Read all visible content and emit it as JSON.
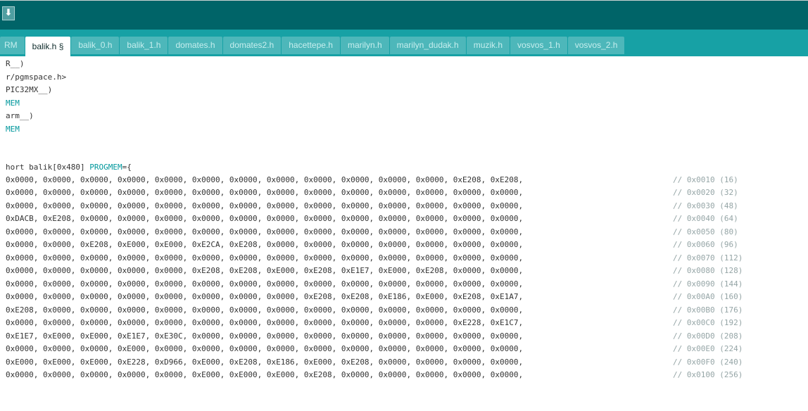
{
  "toolbar": {
    "upload_icon": "upload-arrow-icon",
    "upload_glyph": "🡇"
  },
  "tabs": [
    {
      "label": "RM",
      "active": false
    },
    {
      "label": "balik.h §",
      "active": true
    },
    {
      "label": "balik_0.h",
      "active": false
    },
    {
      "label": "balik_1.h",
      "active": false
    },
    {
      "label": "domates.h",
      "active": false
    },
    {
      "label": "domates2.h",
      "active": false
    },
    {
      "label": "hacettepe.h",
      "active": false
    },
    {
      "label": "marilyn.h",
      "active": false
    },
    {
      "label": "marilyn_dudak.h",
      "active": false
    },
    {
      "label": "muzik.h",
      "active": false
    },
    {
      "label": "vosvos_1.h",
      "active": false
    },
    {
      "label": "vosvos_2.h",
      "active": false
    }
  ],
  "editor": {
    "header_lines": [
      {
        "text": "R__)",
        "style": ""
      },
      {
        "text": "r/pgmspace.h>",
        "style": ""
      },
      {
        "text": "PIC32MX__)",
        "style": ""
      },
      {
        "text": "MEM",
        "style": "kw"
      },
      {
        "text": "arm__)",
        "style": ""
      },
      {
        "text": "MEM",
        "style": "kw"
      }
    ],
    "decl": {
      "prefix": "hort balik[0x480] ",
      "keyword": "PROGMEM",
      "suffix": "={"
    },
    "data_lines": [
      {
        "values": "0x0000, 0x0000, 0x0000, 0x0000, 0x0000, 0x0000, 0x0000, 0x0000, 0x0000, 0x0000, 0x0000, 0x0000, 0xE208, 0xE208,",
        "comment": "// 0x0010 (16)"
      },
      {
        "values": "0x0000, 0x0000, 0x0000, 0x0000, 0x0000, 0x0000, 0x0000, 0x0000, 0x0000, 0x0000, 0x0000, 0x0000, 0x0000, 0x0000,",
        "comment": "// 0x0020 (32)"
      },
      {
        "values": "0x0000, 0x0000, 0x0000, 0x0000, 0x0000, 0x0000, 0x0000, 0x0000, 0x0000, 0x0000, 0x0000, 0x0000, 0x0000, 0x0000,",
        "comment": "// 0x0030 (48)"
      },
      {
        "values": "0xDACB, 0xE208, 0x0000, 0x0000, 0x0000, 0x0000, 0x0000, 0x0000, 0x0000, 0x0000, 0x0000, 0x0000, 0x0000, 0x0000,",
        "comment": "// 0x0040 (64)"
      },
      {
        "values": "0x0000, 0x0000, 0x0000, 0x0000, 0x0000, 0x0000, 0x0000, 0x0000, 0x0000, 0x0000, 0x0000, 0x0000, 0x0000, 0x0000,",
        "comment": "// 0x0050 (80)"
      },
      {
        "values": "0x0000, 0x0000, 0xE208, 0xE000, 0xE000, 0xE2CA, 0xE208, 0x0000, 0x0000, 0x0000, 0x0000, 0x0000, 0x0000, 0x0000,",
        "comment": "// 0x0060 (96)"
      },
      {
        "values": "0x0000, 0x0000, 0x0000, 0x0000, 0x0000, 0x0000, 0x0000, 0x0000, 0x0000, 0x0000, 0x0000, 0x0000, 0x0000, 0x0000,",
        "comment": "// 0x0070 (112)"
      },
      {
        "values": "0x0000, 0x0000, 0x0000, 0x0000, 0x0000, 0xE208, 0xE208, 0xE000, 0xE208, 0xE1E7, 0xE000, 0xE208, 0x0000, 0x0000,",
        "comment": "// 0x0080 (128)"
      },
      {
        "values": "0x0000, 0x0000, 0x0000, 0x0000, 0x0000, 0x0000, 0x0000, 0x0000, 0x0000, 0x0000, 0x0000, 0x0000, 0x0000, 0x0000,",
        "comment": "// 0x0090 (144)"
      },
      {
        "values": "0x0000, 0x0000, 0x0000, 0x0000, 0x0000, 0x0000, 0x0000, 0x0000, 0xE208, 0xE208, 0xE186, 0xE000, 0xE208, 0xE1A7,",
        "comment": "// 0x00A0 (160)"
      },
      {
        "values": "0xE208, 0x0000, 0x0000, 0x0000, 0x0000, 0x0000, 0x0000, 0x0000, 0x0000, 0x0000, 0x0000, 0x0000, 0x0000, 0x0000,",
        "comment": "// 0x00B0 (176)"
      },
      {
        "values": "0x0000, 0x0000, 0x0000, 0x0000, 0x0000, 0x0000, 0x0000, 0x0000, 0x0000, 0x0000, 0x0000, 0x0000, 0xE228, 0xE1C7,",
        "comment": "// 0x00C0 (192)"
      },
      {
        "values": "0xE1E7, 0xE000, 0xE000, 0xE1E7, 0xE30C, 0x0000, 0x0000, 0x0000, 0x0000, 0x0000, 0x0000, 0x0000, 0x0000, 0x0000,",
        "comment": "// 0x00D0 (208)"
      },
      {
        "values": "0x0000, 0x0000, 0x0000, 0xE000, 0x0000, 0x0000, 0x0000, 0x0000, 0x0000, 0x0000, 0x0000, 0x0000, 0x0000, 0x0000,",
        "comment": "// 0x00E0 (224)"
      },
      {
        "values": "0xE000, 0xE000, 0xE000, 0xE228, 0xD966, 0xE000, 0xE208, 0xE186, 0xE000, 0xE208, 0x0000, 0x0000, 0x0000, 0x0000,",
        "comment": "// 0x00F0 (240)"
      },
      {
        "values": "0x0000, 0x0000, 0x0000, 0x0000, 0x0000, 0xE000, 0xE000, 0xE000, 0xE208, 0x0000, 0x0000, 0x0000, 0x0000, 0x0000,",
        "comment": "// 0x0100 (256)"
      }
    ]
  }
}
